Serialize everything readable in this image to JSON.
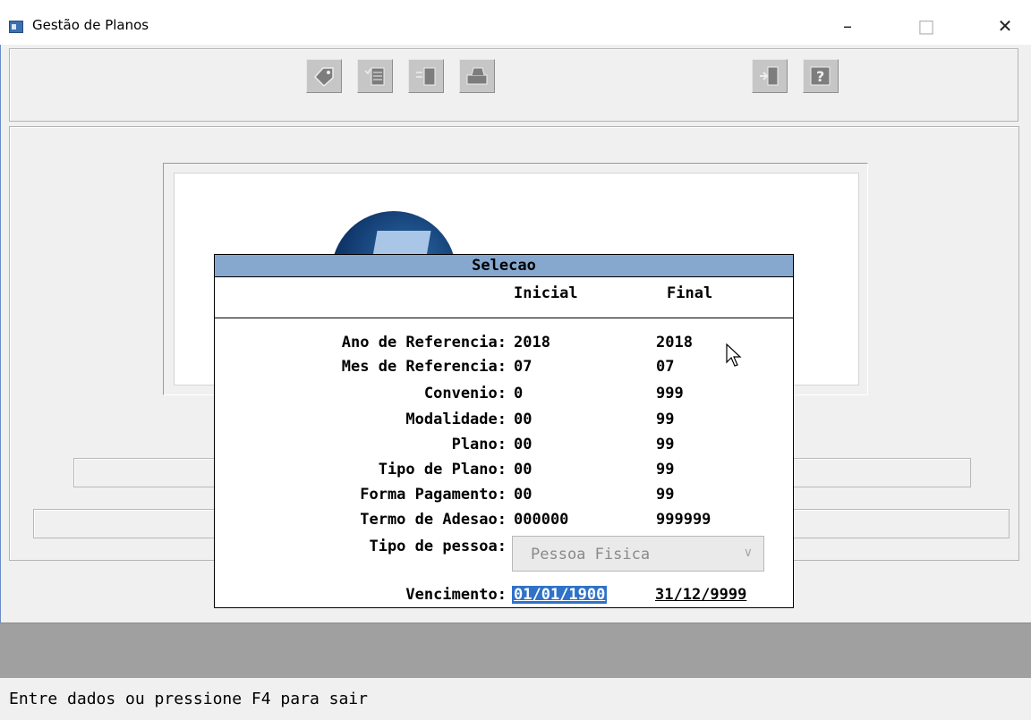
{
  "window": {
    "title": "Gestão de Planos",
    "minimize_glyph": "–",
    "maximize_glyph": "□",
    "close_glyph": "✕"
  },
  "toolbar": {
    "buttons": [
      {
        "name": "tag-icon"
      },
      {
        "name": "checklist-icon"
      },
      {
        "name": "list-arrow-icon"
      },
      {
        "name": "printer-icon"
      },
      {
        "name": "exit-door-icon"
      },
      {
        "name": "help-icon"
      }
    ]
  },
  "dialog": {
    "title": "Selecao",
    "header_initial": "Inicial",
    "header_final": "Final",
    "rows": [
      {
        "label": "Ano de Referencia:",
        "initial": "2018",
        "final": "2018"
      },
      {
        "label": "Mes de Referencia:",
        "initial": "07",
        "final": "07"
      },
      {
        "label": "Convenio:",
        "initial": "0",
        "final": "999"
      },
      {
        "label": "Modalidade:",
        "initial": "00",
        "final": "99"
      },
      {
        "label": "Plano:",
        "initial": "00",
        "final": "99"
      },
      {
        "label": "Tipo de Plano:",
        "initial": "00",
        "final": "99"
      },
      {
        "label": "Forma Pagamento:",
        "initial": "00",
        "final": "99"
      },
      {
        "label": "Termo de Adesao:",
        "initial": "000000",
        "final": "999999"
      }
    ],
    "tipo_pessoa_label": "Tipo de pessoa:",
    "tipo_pessoa_value": "Pessoa Fisica",
    "vencimento_label": "Vencimento:",
    "vencimento_initial": "01/01/1900",
    "vencimento_final": "31/12/9999"
  },
  "status": {
    "message": "Entre dados ou pressione F4 para sair"
  },
  "colors": {
    "dialog_title_bg": "#86a8cf",
    "selection_bg": "#2f72c8",
    "status_band": "#a0a0a0"
  }
}
